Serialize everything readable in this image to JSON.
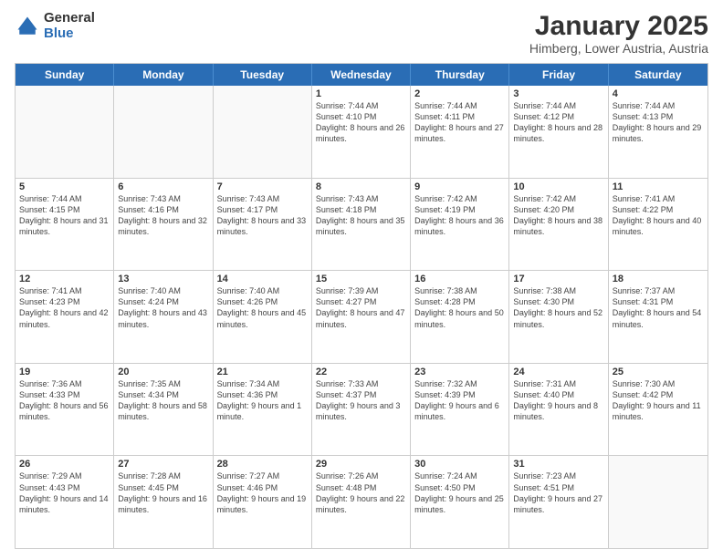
{
  "logo": {
    "general": "General",
    "blue": "Blue"
  },
  "title": "January 2025",
  "subtitle": "Himberg, Lower Austria, Austria",
  "days": [
    "Sunday",
    "Monday",
    "Tuesday",
    "Wednesday",
    "Thursday",
    "Friday",
    "Saturday"
  ],
  "rows": [
    [
      {
        "day": "",
        "info": "",
        "empty": true
      },
      {
        "day": "",
        "info": "",
        "empty": true
      },
      {
        "day": "",
        "info": "",
        "empty": true
      },
      {
        "day": "1",
        "info": "Sunrise: 7:44 AM\nSunset: 4:10 PM\nDaylight: 8 hours and 26 minutes."
      },
      {
        "day": "2",
        "info": "Sunrise: 7:44 AM\nSunset: 4:11 PM\nDaylight: 8 hours and 27 minutes."
      },
      {
        "day": "3",
        "info": "Sunrise: 7:44 AM\nSunset: 4:12 PM\nDaylight: 8 hours and 28 minutes."
      },
      {
        "day": "4",
        "info": "Sunrise: 7:44 AM\nSunset: 4:13 PM\nDaylight: 8 hours and 29 minutes."
      }
    ],
    [
      {
        "day": "5",
        "info": "Sunrise: 7:44 AM\nSunset: 4:15 PM\nDaylight: 8 hours and 31 minutes."
      },
      {
        "day": "6",
        "info": "Sunrise: 7:43 AM\nSunset: 4:16 PM\nDaylight: 8 hours and 32 minutes."
      },
      {
        "day": "7",
        "info": "Sunrise: 7:43 AM\nSunset: 4:17 PM\nDaylight: 8 hours and 33 minutes."
      },
      {
        "day": "8",
        "info": "Sunrise: 7:43 AM\nSunset: 4:18 PM\nDaylight: 8 hours and 35 minutes."
      },
      {
        "day": "9",
        "info": "Sunrise: 7:42 AM\nSunset: 4:19 PM\nDaylight: 8 hours and 36 minutes."
      },
      {
        "day": "10",
        "info": "Sunrise: 7:42 AM\nSunset: 4:20 PM\nDaylight: 8 hours and 38 minutes."
      },
      {
        "day": "11",
        "info": "Sunrise: 7:41 AM\nSunset: 4:22 PM\nDaylight: 8 hours and 40 minutes."
      }
    ],
    [
      {
        "day": "12",
        "info": "Sunrise: 7:41 AM\nSunset: 4:23 PM\nDaylight: 8 hours and 42 minutes."
      },
      {
        "day": "13",
        "info": "Sunrise: 7:40 AM\nSunset: 4:24 PM\nDaylight: 8 hours and 43 minutes."
      },
      {
        "day": "14",
        "info": "Sunrise: 7:40 AM\nSunset: 4:26 PM\nDaylight: 8 hours and 45 minutes."
      },
      {
        "day": "15",
        "info": "Sunrise: 7:39 AM\nSunset: 4:27 PM\nDaylight: 8 hours and 47 minutes."
      },
      {
        "day": "16",
        "info": "Sunrise: 7:38 AM\nSunset: 4:28 PM\nDaylight: 8 hours and 50 minutes."
      },
      {
        "day": "17",
        "info": "Sunrise: 7:38 AM\nSunset: 4:30 PM\nDaylight: 8 hours and 52 minutes."
      },
      {
        "day": "18",
        "info": "Sunrise: 7:37 AM\nSunset: 4:31 PM\nDaylight: 8 hours and 54 minutes."
      }
    ],
    [
      {
        "day": "19",
        "info": "Sunrise: 7:36 AM\nSunset: 4:33 PM\nDaylight: 8 hours and 56 minutes."
      },
      {
        "day": "20",
        "info": "Sunrise: 7:35 AM\nSunset: 4:34 PM\nDaylight: 8 hours and 58 minutes."
      },
      {
        "day": "21",
        "info": "Sunrise: 7:34 AM\nSunset: 4:36 PM\nDaylight: 9 hours and 1 minute."
      },
      {
        "day": "22",
        "info": "Sunrise: 7:33 AM\nSunset: 4:37 PM\nDaylight: 9 hours and 3 minutes."
      },
      {
        "day": "23",
        "info": "Sunrise: 7:32 AM\nSunset: 4:39 PM\nDaylight: 9 hours and 6 minutes."
      },
      {
        "day": "24",
        "info": "Sunrise: 7:31 AM\nSunset: 4:40 PM\nDaylight: 9 hours and 8 minutes."
      },
      {
        "day": "25",
        "info": "Sunrise: 7:30 AM\nSunset: 4:42 PM\nDaylight: 9 hours and 11 minutes."
      }
    ],
    [
      {
        "day": "26",
        "info": "Sunrise: 7:29 AM\nSunset: 4:43 PM\nDaylight: 9 hours and 14 minutes."
      },
      {
        "day": "27",
        "info": "Sunrise: 7:28 AM\nSunset: 4:45 PM\nDaylight: 9 hours and 16 minutes."
      },
      {
        "day": "28",
        "info": "Sunrise: 7:27 AM\nSunset: 4:46 PM\nDaylight: 9 hours and 19 minutes."
      },
      {
        "day": "29",
        "info": "Sunrise: 7:26 AM\nSunset: 4:48 PM\nDaylight: 9 hours and 22 minutes."
      },
      {
        "day": "30",
        "info": "Sunrise: 7:24 AM\nSunset: 4:50 PM\nDaylight: 9 hours and 25 minutes."
      },
      {
        "day": "31",
        "info": "Sunrise: 7:23 AM\nSunset: 4:51 PM\nDaylight: 9 hours and 27 minutes."
      },
      {
        "day": "",
        "info": "",
        "empty": true
      }
    ]
  ]
}
